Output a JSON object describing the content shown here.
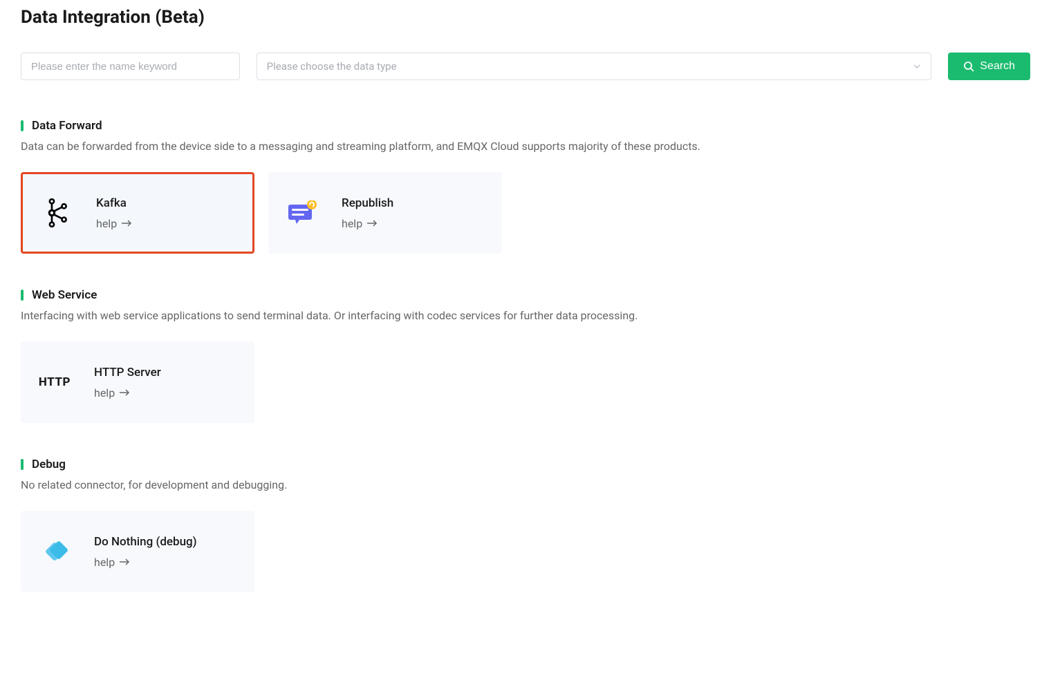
{
  "page_title": "Data Integration (Beta)",
  "search": {
    "name_placeholder": "Please enter the name keyword",
    "type_placeholder": "Please choose the data type",
    "button_label": "Search"
  },
  "sections": {
    "data_forward": {
      "title": "Data Forward",
      "description": "Data can be forwarded from the device side to a messaging and streaming platform, and EMQX Cloud supports majority of these products.",
      "cards": {
        "kafka": {
          "title": "Kafka",
          "help_label": "help"
        },
        "republish": {
          "title": "Republish",
          "help_label": "help"
        }
      }
    },
    "web_service": {
      "title": "Web Service",
      "description": "Interfacing with web service applications to send terminal data. Or interfacing with codec services for further data processing.",
      "cards": {
        "http_server": {
          "title": "HTTP Server",
          "help_label": "help",
          "icon_text": "HTTP"
        }
      }
    },
    "debug": {
      "title": "Debug",
      "description": "No related connector, for development and debugging.",
      "cards": {
        "do_nothing": {
          "title": "Do Nothing (debug)",
          "help_label": "help"
        }
      }
    }
  }
}
